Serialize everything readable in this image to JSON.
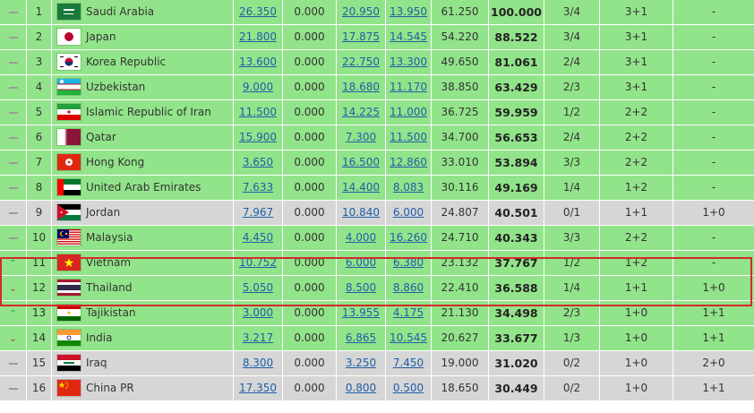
{
  "colors": {
    "green_row": "#92e48a",
    "grey_row": "#d6d6d6",
    "link": "#1f5fa8",
    "highlight": "#d42a2a"
  },
  "rows": [
    {
      "trend": "none",
      "rank": "1",
      "team": "Saudi Arabia",
      "flag": "saudi-arabia",
      "a": "26.350",
      "b": "0.000",
      "c": "20.950",
      "d": "13.950",
      "e": "61.250",
      "pts": "100.000",
      "rec": "3/4",
      "f": "3+1",
      "g": "-",
      "bg": "g"
    },
    {
      "trend": "none",
      "rank": "2",
      "team": "Japan",
      "flag": "japan",
      "a": "21.800",
      "b": "0.000",
      "c": "17.875",
      "d": "14.545",
      "e": "54.220",
      "pts": "88.522",
      "rec": "3/4",
      "f": "3+1",
      "g": "-",
      "bg": "g"
    },
    {
      "trend": "none",
      "rank": "3",
      "team": "Korea Republic",
      "flag": "korea-republic",
      "a": "13.600",
      "b": "0.000",
      "c": "22.750",
      "d": "13.300",
      "e": "49.650",
      "pts": "81.061",
      "rec": "2/4",
      "f": "3+1",
      "g": "-",
      "bg": "g"
    },
    {
      "trend": "none",
      "rank": "4",
      "team": "Uzbekistan",
      "flag": "uzbekistan",
      "a": "9.000",
      "b": "0.000",
      "c": "18.680",
      "d": "11.170",
      "e": "38.850",
      "pts": "63.429",
      "rec": "2/3",
      "f": "3+1",
      "g": "-",
      "bg": "g"
    },
    {
      "trend": "none",
      "rank": "5",
      "team": "Islamic Republic of Iran",
      "flag": "iran",
      "a": "11.500",
      "b": "0.000",
      "c": "14.225",
      "d": "11.000",
      "e": "36.725",
      "pts": "59.959",
      "rec": "1/2",
      "f": "2+2",
      "g": "-",
      "bg": "g"
    },
    {
      "trend": "none",
      "rank": "6",
      "team": "Qatar",
      "flag": "qatar",
      "a": "15.900",
      "b": "0.000",
      "c": "7.300",
      "d": "11.500",
      "e": "34.700",
      "pts": "56.653",
      "rec": "2/4",
      "f": "2+2",
      "g": "-",
      "bg": "g"
    },
    {
      "trend": "none",
      "rank": "7",
      "team": "Hong Kong",
      "flag": "hong-kong",
      "a": "3.650",
      "b": "0.000",
      "c": "16.500",
      "d": "12.860",
      "e": "33.010",
      "pts": "53.894",
      "rec": "3/3",
      "f": "2+2",
      "g": "-",
      "bg": "g"
    },
    {
      "trend": "none",
      "rank": "8",
      "team": "United Arab Emirates",
      "flag": "uae",
      "a": "7.633",
      "b": "0.000",
      "c": "14.400",
      "d": "8.083",
      "e": "30.116",
      "pts": "49.169",
      "rec": "1/4",
      "f": "1+2",
      "g": "-",
      "bg": "g"
    },
    {
      "trend": "none",
      "rank": "9",
      "team": "Jordan",
      "flag": "jordan",
      "a": "7.967",
      "b": "0.000",
      "c": "10.840",
      "d": "6.000",
      "e": "24.807",
      "pts": "40.501",
      "rec": "0/1",
      "f": "1+1",
      "g": "1+0",
      "bg": "x"
    },
    {
      "trend": "none",
      "rank": "10",
      "team": "Malaysia",
      "flag": "malaysia",
      "a": "4.450",
      "b": "0.000",
      "c": "4.000",
      "d": "16.260",
      "e": "24.710",
      "pts": "40.343",
      "rec": "3/3",
      "f": "2+2",
      "g": "-",
      "bg": "g"
    },
    {
      "trend": "up",
      "rank": "11",
      "team": "Vietnam",
      "flag": "vietnam",
      "a": "10.752",
      "b": "0.000",
      "c": "6.000",
      "d": "6.380",
      "e": "23.132",
      "pts": "37.767",
      "rec": "1/2",
      "f": "1+2",
      "g": "-",
      "bg": "g"
    },
    {
      "trend": "down",
      "rank": "12",
      "team": "Thailand",
      "flag": "thailand",
      "a": "5.050",
      "b": "0.000",
      "c": "8.500",
      "d": "8.860",
      "e": "22.410",
      "pts": "36.588",
      "rec": "1/4",
      "f": "1+1",
      "g": "1+0",
      "bg": "g"
    },
    {
      "trend": "up",
      "rank": "13",
      "team": "Tajikistan",
      "flag": "tajikistan",
      "a": "3.000",
      "b": "0.000",
      "c": "13.955",
      "d": "4.175",
      "e": "21.130",
      "pts": "34.498",
      "rec": "2/3",
      "f": "1+0",
      "g": "1+1",
      "bg": "g"
    },
    {
      "trend": "down",
      "rank": "14",
      "team": "India",
      "flag": "india",
      "a": "3.217",
      "b": "0.000",
      "c": "6.865",
      "d": "10.545",
      "e": "20.627",
      "pts": "33.677",
      "rec": "1/3",
      "f": "1+0",
      "g": "1+1",
      "bg": "g"
    },
    {
      "trend": "none",
      "rank": "15",
      "team": "Iraq",
      "flag": "iraq",
      "a": "8.300",
      "b": "0.000",
      "c": "3.250",
      "d": "7.450",
      "e": "19.000",
      "pts": "31.020",
      "rec": "0/2",
      "f": "1+0",
      "g": "2+0",
      "bg": "x"
    },
    {
      "trend": "none",
      "rank": "16",
      "team": "China PR",
      "flag": "china",
      "a": "17.350",
      "b": "0.000",
      "c": "0.800",
      "d": "0.500",
      "e": "18.650",
      "pts": "30.449",
      "rec": "0/2",
      "f": "1+0",
      "g": "1+1",
      "bg": "x"
    }
  ]
}
